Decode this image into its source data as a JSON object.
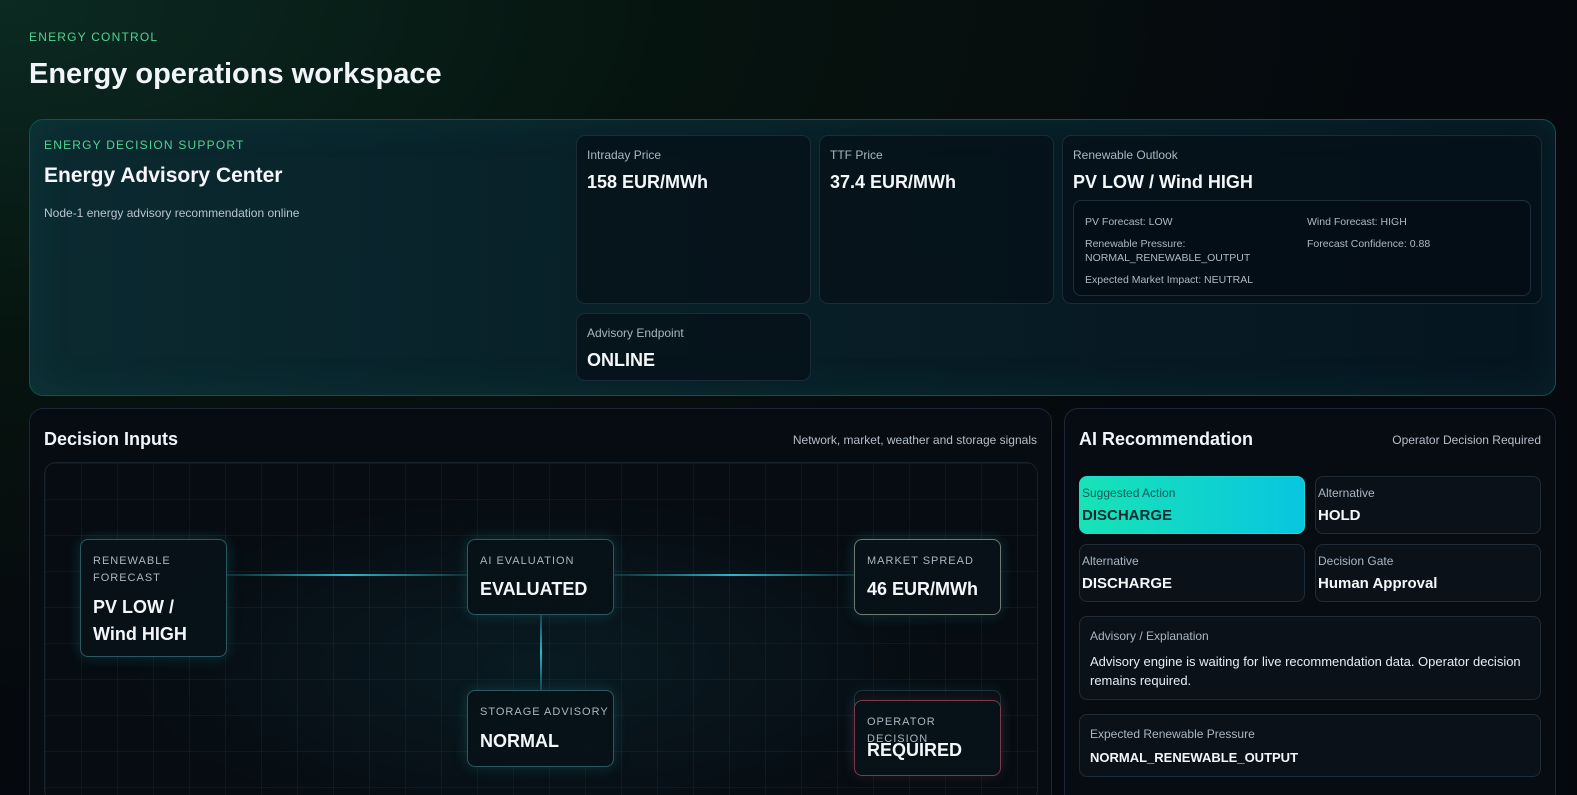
{
  "header": {
    "eyebrow": "ENERGY CONTROL",
    "title": "Energy operations workspace"
  },
  "hero": {
    "eyebrow": "ENERGY DECISION SUPPORT",
    "title": "Energy Advisory Center",
    "subtitle": "Node-1 energy advisory recommendation online",
    "intraday": {
      "label": "Intraday Price",
      "value": "158 EUR/MWh"
    },
    "ttf": {
      "label": "TTF Price",
      "value": "37.4 EUR/MWh"
    },
    "renewable": {
      "label": "Renewable Outlook",
      "value": "PV LOW / Wind HIGH",
      "pv_forecast": "PV Forecast: LOW",
      "wind_forecast": "Wind Forecast: HIGH",
      "pressure_line1": "Renewable Pressure:",
      "pressure_line2": "NORMAL_RENEWABLE_OUTPUT",
      "confidence": "Forecast Confidence: 0.88",
      "market_impact": "Expected Market Impact: NEUTRAL"
    },
    "endpoint": {
      "label": "Advisory Endpoint",
      "value": "ONLINE"
    }
  },
  "inputs": {
    "title": "Decision Inputs",
    "note": "Network, market, weather and storage signals",
    "nodes": {
      "renewable": {
        "label_line1": "RENEWABLE",
        "label_line2": "FORECAST",
        "value_line1": "PV LOW /",
        "value_line2": "Wind HIGH"
      },
      "ai": {
        "label": "AI EVALUATION",
        "value": "EVALUATED"
      },
      "market": {
        "label": "MARKET SPREAD",
        "value": "46 EUR/MWh"
      },
      "storage": {
        "label": "STORAGE ADVISORY",
        "value": "NORMAL"
      },
      "operator": {
        "label": "OPERATOR DECISION",
        "value": "REQUIRED"
      }
    }
  },
  "recommendation": {
    "title": "AI Recommendation",
    "note": "Operator Decision Required",
    "suggested": {
      "label": "Suggested Action",
      "value": "DISCHARGE"
    },
    "alt1": {
      "label": "Alternative",
      "value": "HOLD"
    },
    "alt2": {
      "label": "Alternative",
      "value": "DISCHARGE"
    },
    "gate": {
      "label": "Decision Gate",
      "value": "Human Approval"
    },
    "explanation": {
      "label": "Advisory / Explanation",
      "text": "Advisory engine is waiting for live recommendation data. Operator decision remains required."
    },
    "pressure": {
      "label": "Expected Renewable Pressure",
      "value": "NORMAL_RENEWABLE_OUTPUT"
    }
  }
}
